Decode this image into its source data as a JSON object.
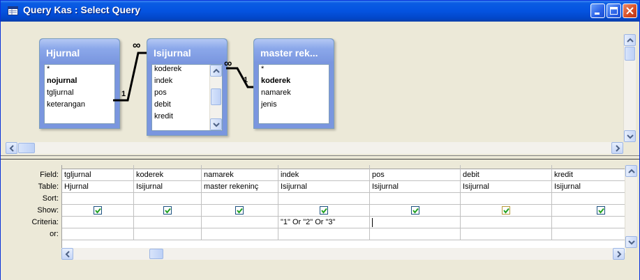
{
  "window": {
    "title": "Query Kas : Select Query",
    "title_icon": "query-icon",
    "controls": [
      "minimize-icon",
      "maximize-icon",
      "close-icon"
    ]
  },
  "tables": [
    {
      "name": "Hjurnal",
      "fields": [
        {
          "label": "*",
          "key": false
        },
        {
          "label": "nojurnal",
          "key": true
        },
        {
          "label": "tgljurnal",
          "key": false
        },
        {
          "label": "keterangan",
          "key": false
        }
      ]
    },
    {
      "name": "Isijurnal",
      "fields": [
        {
          "label": "koderek",
          "key": false
        },
        {
          "label": "indek",
          "key": false
        },
        {
          "label": "pos",
          "key": false
        },
        {
          "label": "debit",
          "key": false
        },
        {
          "label": "kredit",
          "key": false
        }
      ]
    },
    {
      "name": "master rek...",
      "fields": [
        {
          "label": "*",
          "key": false
        },
        {
          "label": "koderek",
          "key": true
        },
        {
          "label": "namarek",
          "key": false
        },
        {
          "label": "jenis",
          "key": false
        }
      ]
    }
  ],
  "joins": [
    {
      "one": "1",
      "many": "∞"
    },
    {
      "one": "1",
      "many": "∞"
    }
  ],
  "grid": {
    "row_headers": [
      "Field:",
      "Table:",
      "Sort:",
      "Show:",
      "Criteria:",
      "or:"
    ],
    "columns": [
      {
        "field": "tgljurnal",
        "table": "Hjurnal",
        "sort": "",
        "show": true,
        "criteria": "",
        "or": ""
      },
      {
        "field": "koderek",
        "table": "Isijurnal",
        "sort": "",
        "show": true,
        "criteria": "",
        "or": ""
      },
      {
        "field": "namarek",
        "table": "master rekeninç",
        "sort": "",
        "show": true,
        "criteria": "",
        "or": ""
      },
      {
        "field": "indek",
        "table": "Isijurnal",
        "sort": "",
        "show": true,
        "criteria": "\"1\" Or \"2\" Or \"3\"",
        "or": ""
      },
      {
        "field": "pos",
        "table": "Isijurnal",
        "sort": "",
        "show": true,
        "criteria": "",
        "or": ""
      },
      {
        "field": "debit",
        "table": "Isijurnal",
        "sort": "",
        "show": true,
        "criteria": "",
        "or": ""
      },
      {
        "field": "kredit",
        "table": "Isijurnal",
        "sort": "",
        "show": true,
        "criteria": "",
        "or": ""
      }
    ]
  },
  "colors": {
    "titlebar": "#0453e0",
    "check": "#21a121",
    "table_header": "#7a96df"
  }
}
